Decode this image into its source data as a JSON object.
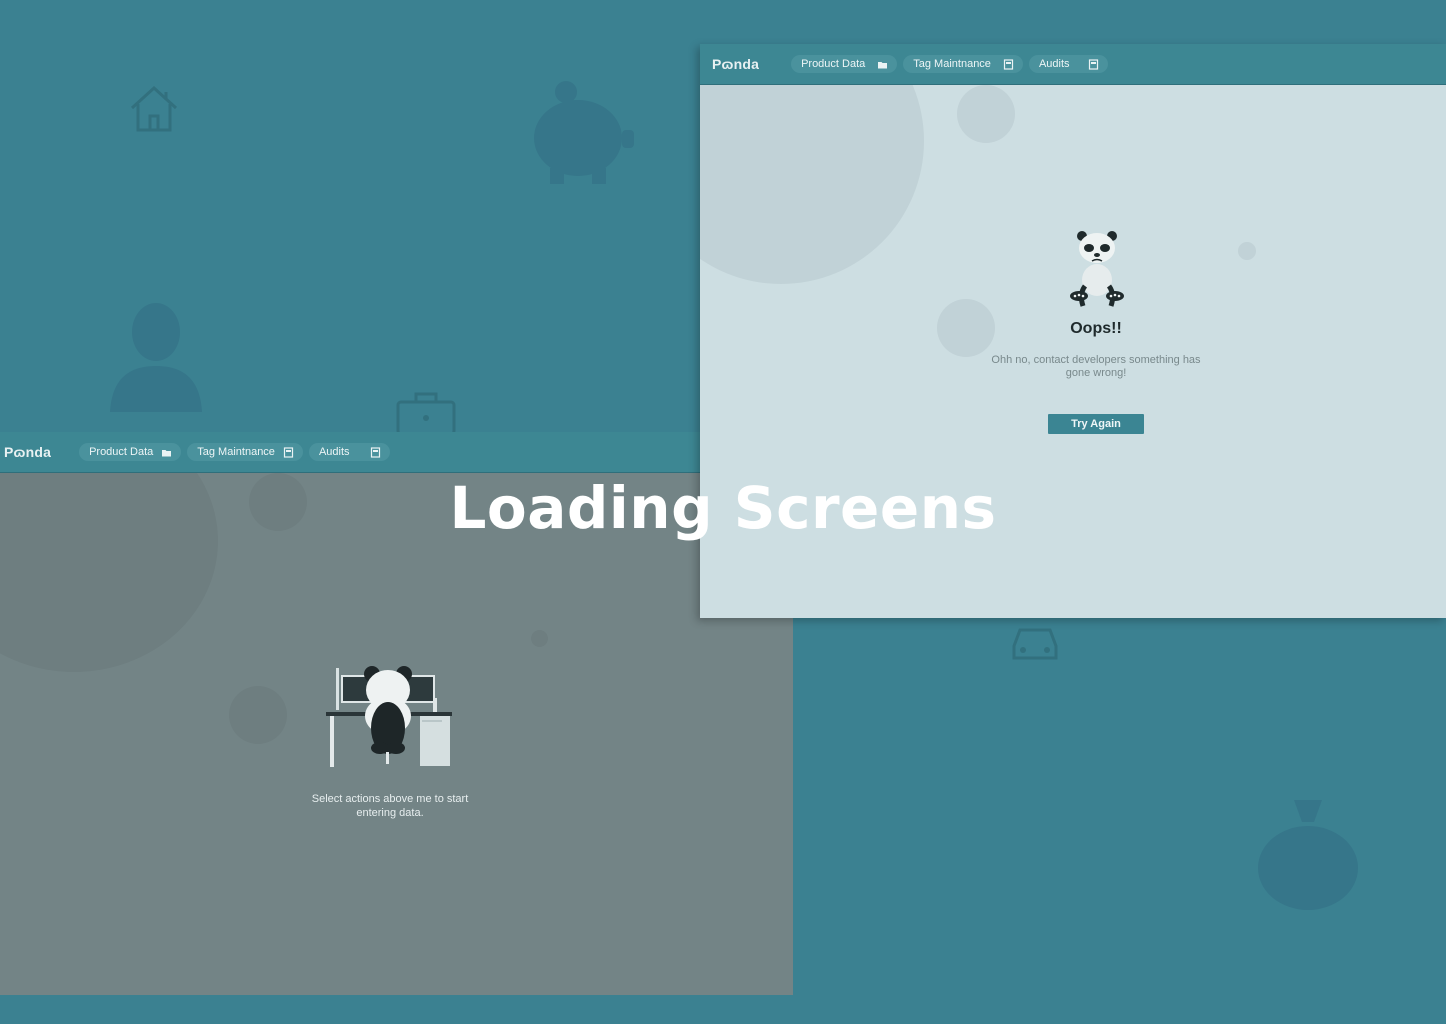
{
  "headline": "Loading Screens",
  "theme": {
    "primary": "#3b8191",
    "nav": "#3d8793",
    "error_bg": "#cddee2",
    "empty_bg": "#738486",
    "button": "#3b8593"
  },
  "error_screen": {
    "logo": "Pɷnda",
    "nav": [
      {
        "label": "Product Data",
        "icon": "folder-icon"
      },
      {
        "label": "Tag Maintnance",
        "icon": "document-icon"
      },
      {
        "label": "Audits",
        "icon": "document-icon"
      }
    ],
    "title": "Oops!!",
    "message": "Ohh no, contact developers something has gone wrong!",
    "button": "Try Again"
  },
  "empty_screen": {
    "logo": "Pɷnda",
    "nav": [
      {
        "label": "Product Data",
        "icon": "folder-icon"
      },
      {
        "label": "Tag Maintnance",
        "icon": "document-icon"
      },
      {
        "label": "Audits",
        "icon": "document-icon"
      }
    ],
    "message": "Select actions above me to start entering data."
  }
}
